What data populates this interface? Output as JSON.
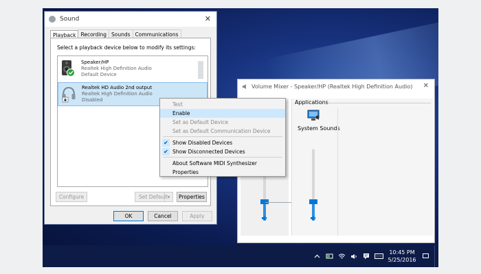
{
  "sound_dialog": {
    "title": "Sound",
    "close_glyph": "✕",
    "tabs": [
      {
        "label": "Playback",
        "active": true
      },
      {
        "label": "Recording"
      },
      {
        "label": "Sounds"
      },
      {
        "label": "Communications"
      }
    ],
    "instruction": "Select a playback device below to modify its settings:",
    "devices": [
      {
        "name": "Speaker/HP",
        "driver": "Realtek High Definition Audio",
        "status": "Default Device",
        "icon": "speaker-icon",
        "badge": "green-check-badge"
      },
      {
        "name": "Realtek HD Audio 2nd output",
        "driver": "Realtek High Definition Audio",
        "status": "Disabled",
        "icon": "headphones-icon",
        "badge": "down-arrow-badge",
        "selected": true
      }
    ],
    "buttons": {
      "configure": "Configure",
      "set_default": "Set Default",
      "set_default_arrow": "▾",
      "properties": "Properties",
      "ok": "OK",
      "cancel": "Cancel",
      "apply": "Apply"
    }
  },
  "context_menu": {
    "items": [
      {
        "label": "Test",
        "disabled": true
      },
      {
        "label": "Enable",
        "highlighted": true
      },
      {
        "label": "Set as Default Device",
        "disabled": true
      },
      {
        "label": "Set as Default Communication Device",
        "disabled": true
      },
      {
        "label": "Show Disabled Devices",
        "checked": true
      },
      {
        "label": "Show Disconnected Devices",
        "checked": true
      },
      {
        "label": "About Software MIDI Synthesizer"
      },
      {
        "label": "Properties"
      }
    ],
    "check_glyph": "✔"
  },
  "volume_mixer": {
    "title": "Volume Mixer - Speaker/HP (Realtek High Definition Audio)",
    "close_glyph": "✕",
    "applications_label": "Applications",
    "app_name": "System Sounds",
    "device_volume_level": 0.22,
    "app_volume_level": 0.22,
    "speaker_glyph": "🔈"
  },
  "taskbar": {
    "time": "10:45 PM",
    "date": "5/25/2016",
    "tray_icons": [
      "chevron-up-icon",
      "network-icon",
      "wifi-icon",
      "volume-icon",
      "notification-icon",
      "keyboard-icon"
    ]
  },
  "colors": {
    "accent": "#0078d7",
    "selection": "#cce6f8",
    "menu_highlight": "#cce8ff",
    "desktop_dark": "#0b1c52",
    "taskbar": "#0d1b47"
  }
}
